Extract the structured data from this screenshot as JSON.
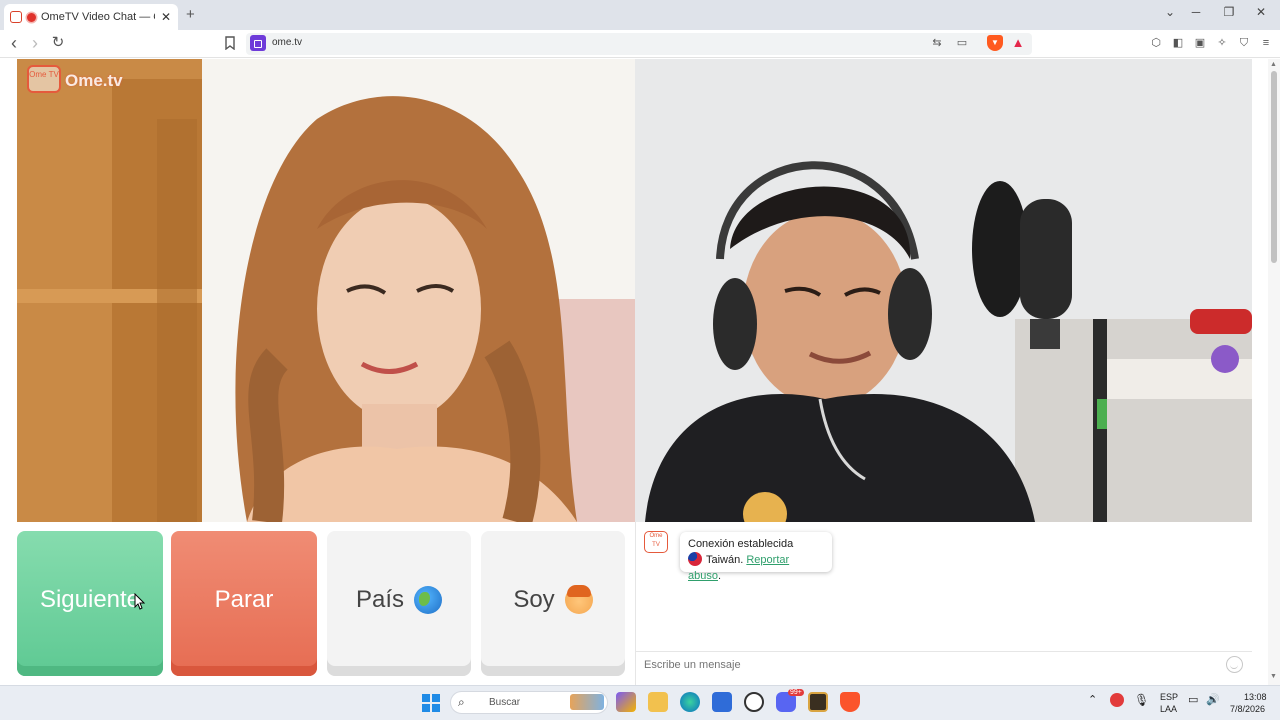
{
  "browser": {
    "tab_title": "OmeTV Video Chat — Omegl",
    "tab_close": "✕",
    "new_tab": "+",
    "url": "ome.tv",
    "window_controls": {
      "list": "⌄",
      "minimize": "─",
      "restore": "❐",
      "close": "✕"
    },
    "nav": {
      "back": "‹",
      "forward": "›",
      "reload": "↻"
    }
  },
  "watermark": {
    "logo_small": "Ome TV",
    "text": "Ome.tv"
  },
  "controls": {
    "next_label": "Siguiente",
    "stop_label": "Parar",
    "country_label": "País",
    "iam_label": "Soy"
  },
  "chat": {
    "logo_text": "Ome TV",
    "status": "Conexión establecida",
    "country": "Taiwán.",
    "report_link": "Reportar abuso",
    "report_suffix": ".",
    "input_placeholder": "Escribe un mensaje"
  },
  "taskbar": {
    "search_placeholder": "Buscar",
    "lang_top": "ESP",
    "lang_bottom": "LAA",
    "time": "13:08",
    "date": "7/8/2026",
    "badge": "99+"
  },
  "colors": {
    "next": "#6fd3a0",
    "stop": "#ea7a60",
    "neutral": "#f3f3f3",
    "ometv_orange": "#e55a3c",
    "report_link": "#2f9f6c"
  }
}
